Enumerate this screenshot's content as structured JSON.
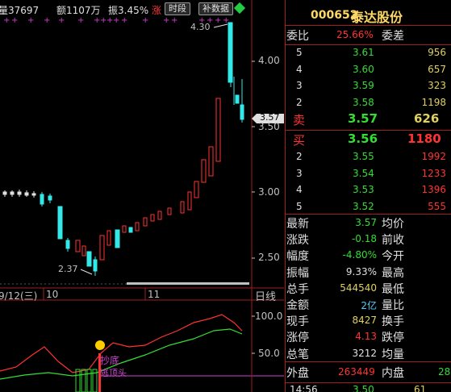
{
  "topbar": {
    "volume": "量37697",
    "amount": "额1107万",
    "amplitude": "振3.45%",
    "sell_char": "涨",
    "btn_timeframe": "时段",
    "btn_data": "补数据"
  },
  "kline": {
    "high_label": "4.30",
    "low_label": "2.37",
    "price_tag": "3.57",
    "ticks": [
      "4.00",
      "3.50",
      "3.00",
      "2.50"
    ]
  },
  "date_axis": {
    "date_label": "9/12(三)",
    "mark1": "10",
    "mark2": "11",
    "period": "日线"
  },
  "indicator": {
    "ticks": [
      "100.0",
      "50.0"
    ],
    "text1": "抄底",
    "text2": "逃顶头"
  },
  "quote": {
    "code": "000652",
    "name": "泰达股份",
    "weibi_label": "委比",
    "weibi_value": "25.66%",
    "weicha_label": "委差",
    "sell_rows": [
      {
        "level": "5",
        "price": "3.61",
        "vol": "956"
      },
      {
        "level": "4",
        "price": "3.60",
        "vol": "657"
      },
      {
        "level": "3",
        "price": "3.59",
        "vol": "323"
      },
      {
        "level": "2",
        "price": "3.58",
        "vol": "1198"
      }
    ],
    "sell1": {
      "label": "卖",
      "price": "3.57",
      "vol": "626"
    },
    "buy1": {
      "label": "买",
      "price": "3.56",
      "vol": "1180"
    },
    "buy_rows": [
      {
        "level": "2",
        "price": "3.55",
        "vol": "1992"
      },
      {
        "level": "3",
        "price": "3.54",
        "vol": "1233"
      },
      {
        "level": "4",
        "price": "3.53",
        "vol": "1396"
      },
      {
        "level": "5",
        "price": "3.52",
        "vol": "555"
      }
    ],
    "stats": [
      {
        "l1": "最新",
        "v1": "3.57",
        "l2": "均价"
      },
      {
        "l1": "涨跌",
        "v1": "-0.18",
        "l2": "前收"
      },
      {
        "l1": "幅度",
        "v1": "-4.80%",
        "l2": "今开"
      },
      {
        "l1": "振幅",
        "v1": "9.33%",
        "l2": "最高"
      },
      {
        "l1": "总手",
        "v1": "544540",
        "l2": "最低"
      },
      {
        "l1": "金额",
        "v1": "2亿",
        "l2": "量比"
      },
      {
        "l1": "现手",
        "v1": "8427",
        "l2": "换手"
      },
      {
        "l1": "涨停",
        "v1": "4.13",
        "l2": "跌停"
      },
      {
        "l1": "总笔",
        "v1": "3212",
        "l2": "均量"
      }
    ],
    "outer_label": "外盘",
    "outer_value": "263449",
    "inner_label": "内盘",
    "inner_value": "28",
    "tick_time": "14:56",
    "tick_price": "3.50",
    "tick_vol": "61"
  },
  "colors": {
    "up": "#ff3333",
    "down": "#33dd33",
    "divider": "#a02020",
    "accent_yellow": "#ffd966"
  }
}
